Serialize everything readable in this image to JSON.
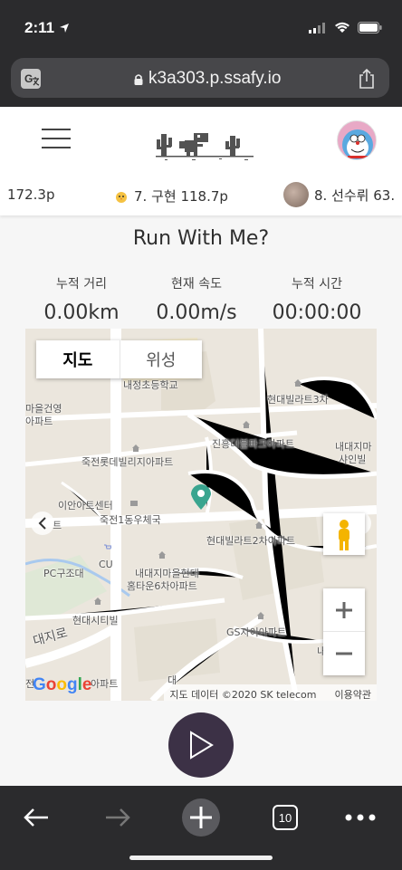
{
  "status": {
    "time": "2:11"
  },
  "browser": {
    "url": "k3a303.p.ssafy.io",
    "tabs_count": "10"
  },
  "header": {
    "ticker": {
      "item_prev": "172.3p",
      "item_7": "7. 구현 118.7p",
      "item_8": "8. 선수뤼 63."
    }
  },
  "main": {
    "title": "Run With Me?",
    "stats": [
      {
        "label": "누적 거리",
        "value": "0.00km"
      },
      {
        "label": "현재 속도",
        "value": "0.00m/s"
      },
      {
        "label": "누적 시간",
        "value": "00:00:00"
      }
    ]
  },
  "map": {
    "tabs": [
      "지도",
      "위성"
    ],
    "labels": {
      "school": "내정초등학교",
      "hyundai3": "현대빌라트3차",
      "maeulgeonyoung": "마을건영",
      "apt": "아파트",
      "jinheung": "진흥더블파크아파트",
      "naedaejimeul": "내대지마",
      "syanvil": "샤인빌",
      "lotte": "죽전롯데빌리지아파트",
      "ian": "이안아트센터",
      "post": "죽전1동우체국",
      "mart": "트",
      "hyundai2": "현대빌라트2차아파트",
      "pc": "PC구조대",
      "cu": "CU",
      "hometown1": "내대지마을현대",
      "hometown2": "홈타운6차아파트",
      "city": "현대시티빌",
      "gs": "GS자이아파트",
      "road": "대지로",
      "n_right": "내",
      "apt_bottom": "아파트",
      "left_bottom": "전",
      "road_bottom": "대"
    },
    "attribution": "지도 데이터 ©2020 SK telecom",
    "terms": "이용약관",
    "google": [
      "G",
      "o",
      "o",
      "g",
      "l",
      "e"
    ],
    "colors": {
      "marker": "#3aa58f",
      "water": "#a9c9ee",
      "road": "#ffffff",
      "land": "#ebe6dd"
    }
  },
  "controls": {
    "play": "play-icon"
  },
  "icons": [
    "location-arrow-icon",
    "signal-icon",
    "wifi-icon",
    "battery-icon",
    "translate-icon",
    "lock-icon",
    "share-icon",
    "hamburger-icon",
    "dino-logo-icon",
    "avatar",
    "pegman-icon",
    "back-icon",
    "forward-icon",
    "new-tab-icon",
    "more-icon"
  ]
}
